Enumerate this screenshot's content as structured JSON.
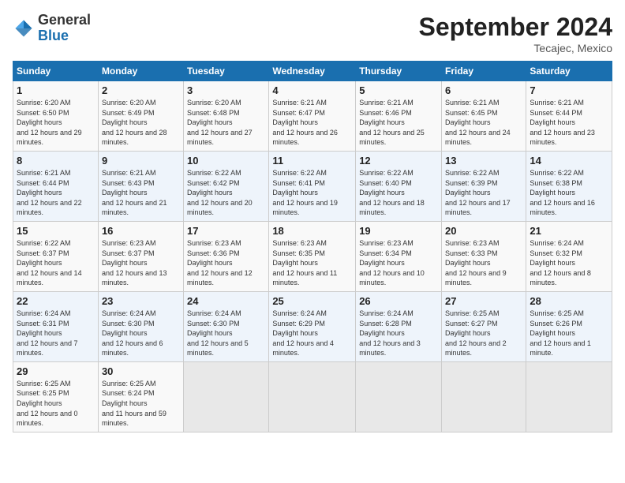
{
  "header": {
    "logo_general": "General",
    "logo_blue": "Blue",
    "month_title": "September 2024",
    "location": "Tecajec, Mexico"
  },
  "columns": [
    "Sunday",
    "Monday",
    "Tuesday",
    "Wednesday",
    "Thursday",
    "Friday",
    "Saturday"
  ],
  "weeks": [
    [
      {
        "day": "1",
        "sunrise": "6:20 AM",
        "sunset": "6:50 PM",
        "daylight": "12 hours and 29 minutes."
      },
      {
        "day": "2",
        "sunrise": "6:20 AM",
        "sunset": "6:49 PM",
        "daylight": "12 hours and 28 minutes."
      },
      {
        "day": "3",
        "sunrise": "6:20 AM",
        "sunset": "6:48 PM",
        "daylight": "12 hours and 27 minutes."
      },
      {
        "day": "4",
        "sunrise": "6:21 AM",
        "sunset": "6:47 PM",
        "daylight": "12 hours and 26 minutes."
      },
      {
        "day": "5",
        "sunrise": "6:21 AM",
        "sunset": "6:46 PM",
        "daylight": "12 hours and 25 minutes."
      },
      {
        "day": "6",
        "sunrise": "6:21 AM",
        "sunset": "6:45 PM",
        "daylight": "12 hours and 24 minutes."
      },
      {
        "day": "7",
        "sunrise": "6:21 AM",
        "sunset": "6:44 PM",
        "daylight": "12 hours and 23 minutes."
      }
    ],
    [
      {
        "day": "8",
        "sunrise": "6:21 AM",
        "sunset": "6:44 PM",
        "daylight": "12 hours and 22 minutes."
      },
      {
        "day": "9",
        "sunrise": "6:21 AM",
        "sunset": "6:43 PM",
        "daylight": "12 hours and 21 minutes."
      },
      {
        "day": "10",
        "sunrise": "6:22 AM",
        "sunset": "6:42 PM",
        "daylight": "12 hours and 20 minutes."
      },
      {
        "day": "11",
        "sunrise": "6:22 AM",
        "sunset": "6:41 PM",
        "daylight": "12 hours and 19 minutes."
      },
      {
        "day": "12",
        "sunrise": "6:22 AM",
        "sunset": "6:40 PM",
        "daylight": "12 hours and 18 minutes."
      },
      {
        "day": "13",
        "sunrise": "6:22 AM",
        "sunset": "6:39 PM",
        "daylight": "12 hours and 17 minutes."
      },
      {
        "day": "14",
        "sunrise": "6:22 AM",
        "sunset": "6:38 PM",
        "daylight": "12 hours and 16 minutes."
      }
    ],
    [
      {
        "day": "15",
        "sunrise": "6:22 AM",
        "sunset": "6:37 PM",
        "daylight": "12 hours and 14 minutes."
      },
      {
        "day": "16",
        "sunrise": "6:23 AM",
        "sunset": "6:37 PM",
        "daylight": "12 hours and 13 minutes."
      },
      {
        "day": "17",
        "sunrise": "6:23 AM",
        "sunset": "6:36 PM",
        "daylight": "12 hours and 12 minutes."
      },
      {
        "day": "18",
        "sunrise": "6:23 AM",
        "sunset": "6:35 PM",
        "daylight": "12 hours and 11 minutes."
      },
      {
        "day": "19",
        "sunrise": "6:23 AM",
        "sunset": "6:34 PM",
        "daylight": "12 hours and 10 minutes."
      },
      {
        "day": "20",
        "sunrise": "6:23 AM",
        "sunset": "6:33 PM",
        "daylight": "12 hours and 9 minutes."
      },
      {
        "day": "21",
        "sunrise": "6:24 AM",
        "sunset": "6:32 PM",
        "daylight": "12 hours and 8 minutes."
      }
    ],
    [
      {
        "day": "22",
        "sunrise": "6:24 AM",
        "sunset": "6:31 PM",
        "daylight": "12 hours and 7 minutes."
      },
      {
        "day": "23",
        "sunrise": "6:24 AM",
        "sunset": "6:30 PM",
        "daylight": "12 hours and 6 minutes."
      },
      {
        "day": "24",
        "sunrise": "6:24 AM",
        "sunset": "6:30 PM",
        "daylight": "12 hours and 5 minutes."
      },
      {
        "day": "25",
        "sunrise": "6:24 AM",
        "sunset": "6:29 PM",
        "daylight": "12 hours and 4 minutes."
      },
      {
        "day": "26",
        "sunrise": "6:24 AM",
        "sunset": "6:28 PM",
        "daylight": "12 hours and 3 minutes."
      },
      {
        "day": "27",
        "sunrise": "6:25 AM",
        "sunset": "6:27 PM",
        "daylight": "12 hours and 2 minutes."
      },
      {
        "day": "28",
        "sunrise": "6:25 AM",
        "sunset": "6:26 PM",
        "daylight": "12 hours and 1 minute."
      }
    ],
    [
      {
        "day": "29",
        "sunrise": "6:25 AM",
        "sunset": "6:25 PM",
        "daylight": "12 hours and 0 minutes."
      },
      {
        "day": "30",
        "sunrise": "6:25 AM",
        "sunset": "6:24 PM",
        "daylight": "11 hours and 59 minutes."
      },
      null,
      null,
      null,
      null,
      null
    ]
  ]
}
